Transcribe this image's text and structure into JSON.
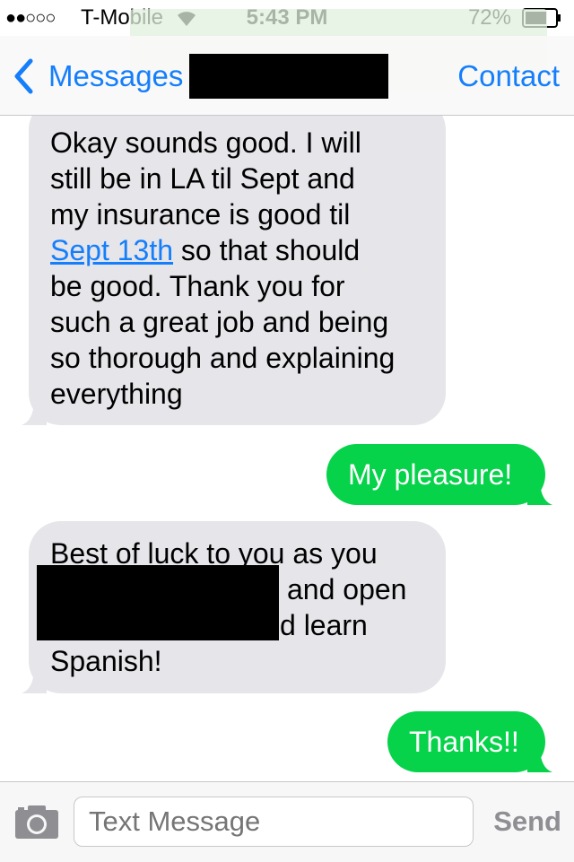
{
  "status_bar": {
    "signal": "●●○○○",
    "carrier": "T-Mobile",
    "time": "5:43 PM",
    "battery_percent": "72%",
    "battery_level": 0.72
  },
  "nav": {
    "back_label": "Messages",
    "contact_label": "Contact"
  },
  "messages": [
    {
      "direction": "incoming",
      "lines": [
        "Okay sounds good. I will",
        "still be in LA til Sept and",
        "my insurance is good til",
        " so that should",
        "be good. Thank you for",
        "such a great job and being",
        "so thorough and explaining",
        "everything"
      ],
      "link_text": "Sept 13th"
    },
    {
      "direction": "outgoing",
      "text": "My pleasure!"
    },
    {
      "direction": "incoming",
      "lines": [
        "Best of luck to you as you",
        "and open",
        "d learn",
        "Spanish!"
      ]
    },
    {
      "direction": "outgoing",
      "text": "Thanks!!"
    }
  ],
  "input": {
    "placeholder": "Text Message",
    "value": "",
    "send_label": "Send"
  },
  "colors": {
    "accent": "#157efb",
    "outgoing_bubble": "#06d24a",
    "incoming_bubble": "#e5e5ea"
  },
  "icons": {
    "signal": "signal-dots-icon",
    "wifi": "wifi-icon",
    "battery": "battery-icon",
    "back": "chevron-left-icon",
    "camera": "camera-icon"
  }
}
